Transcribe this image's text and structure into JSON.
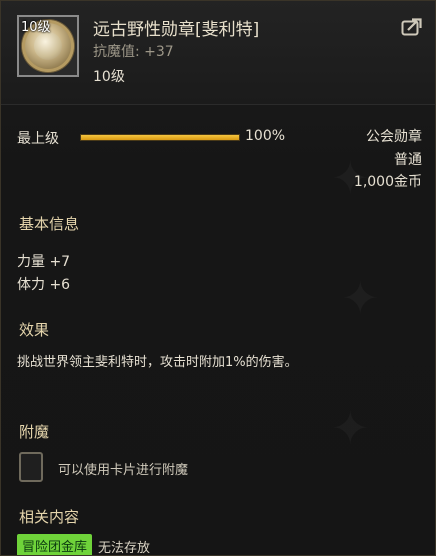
{
  "item": {
    "level_badge": "10级",
    "name": "远古野性勋章[斐利特]",
    "resist_label": "抗魔值:",
    "resist_value": "+37",
    "level_text": "10级"
  },
  "upgrade": {
    "label": "最上级",
    "progress_percent": 100,
    "percent_text": "100%"
  },
  "right_info": {
    "type": "公会勋章",
    "grade": "普通",
    "price": "1,000金币"
  },
  "basic_info": {
    "title": "基本信息",
    "stats": [
      "力量 +7",
      "体力 +6"
    ]
  },
  "effect": {
    "title": "效果",
    "text": "挑战世界领主斐利特时，攻击时附加1%的伤害。"
  },
  "enchant": {
    "title": "附魔",
    "hint": "可以使用卡片进行附魔"
  },
  "related": {
    "title": "相关内容",
    "tag": "冒险团金库",
    "tag_note": "无法存放"
  },
  "colors": {
    "bar_fill": "#f0b52a",
    "tag_green": "#6fd33a",
    "section_title": "#e6d6ad"
  },
  "icons": {
    "item": "medal-icon",
    "share": "share-arrow-icon",
    "card_slot": "card-slot-icon"
  }
}
